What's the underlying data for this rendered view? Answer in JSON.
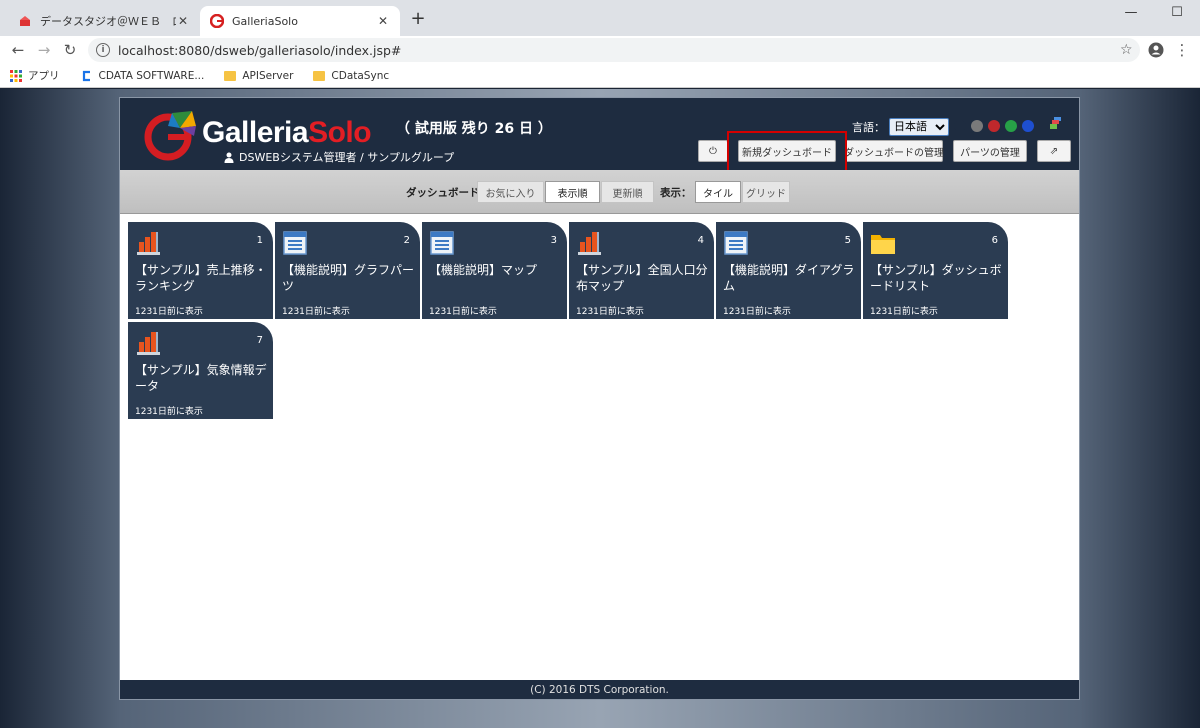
{
  "browser": {
    "tabs": [
      {
        "title": "データスタジオ＠ＷＥＢ　ログイン画面",
        "active": false
      },
      {
        "title": "GalleriaSolo",
        "active": true
      }
    ],
    "new_tab": "+",
    "url": "localhost:8080/dsweb/galleriasolo/index.jsp#",
    "bookmarks": [
      "アプリ",
      "CDATA SOFTWARE...",
      "APIServer",
      "CDataSync"
    ]
  },
  "header": {
    "logo_text_1": "Galleria",
    "logo_text_2": "Solo",
    "trial": "（ 試用版 残り 26 日 ）",
    "user": "DSWEBシステム管理者 / サンプルグループ",
    "lang_label": "言語：",
    "lang_value": "日本語",
    "theme_colors": [
      "#1e2c40",
      "#7a7a7a",
      "#c0282c",
      "#27a047",
      "#1e4fd0"
    ],
    "buttons": {
      "power": "⏻",
      "new_dashboard": "新規ダッシュボード",
      "manage_dashboard": "ダッシュボードの管理",
      "manage_parts": "パーツの管理",
      "external": "⇗"
    }
  },
  "subbar": {
    "dashboard_label": "ダッシュボード：",
    "favorites": "お気に入り",
    "display_order": "表示順",
    "update_order": "更新順",
    "view_label": "表示：",
    "tile": "タイル",
    "grid": "グリッド"
  },
  "tiles": [
    {
      "num": "1",
      "title": "【サンプル】売上推移・ランキング",
      "footer": "1231日前に表示",
      "icon": "bar-chart-icon"
    },
    {
      "num": "2",
      "title": "【機能説明】グラフパーツ",
      "footer": "1231日前に表示",
      "icon": "document-icon"
    },
    {
      "num": "3",
      "title": "【機能説明】マップ",
      "footer": "1231日前に表示",
      "icon": "document-icon"
    },
    {
      "num": "4",
      "title": "【サンプル】全国人口分布マップ",
      "footer": "1231日前に表示",
      "icon": "bar-chart-icon"
    },
    {
      "num": "5",
      "title": "【機能説明】ダイアグラム",
      "footer": "1231日前に表示",
      "icon": "document-icon"
    },
    {
      "num": "6",
      "title": "【サンプル】ダッシュボードリスト",
      "footer": "1231日前に表示",
      "icon": "folder-icon"
    },
    {
      "num": "7",
      "title": "【サンプル】気象情報データ",
      "footer": "1231日前に表示",
      "icon": "bar-chart-icon"
    }
  ],
  "footer": "(C) 2016 DTS Corporation."
}
